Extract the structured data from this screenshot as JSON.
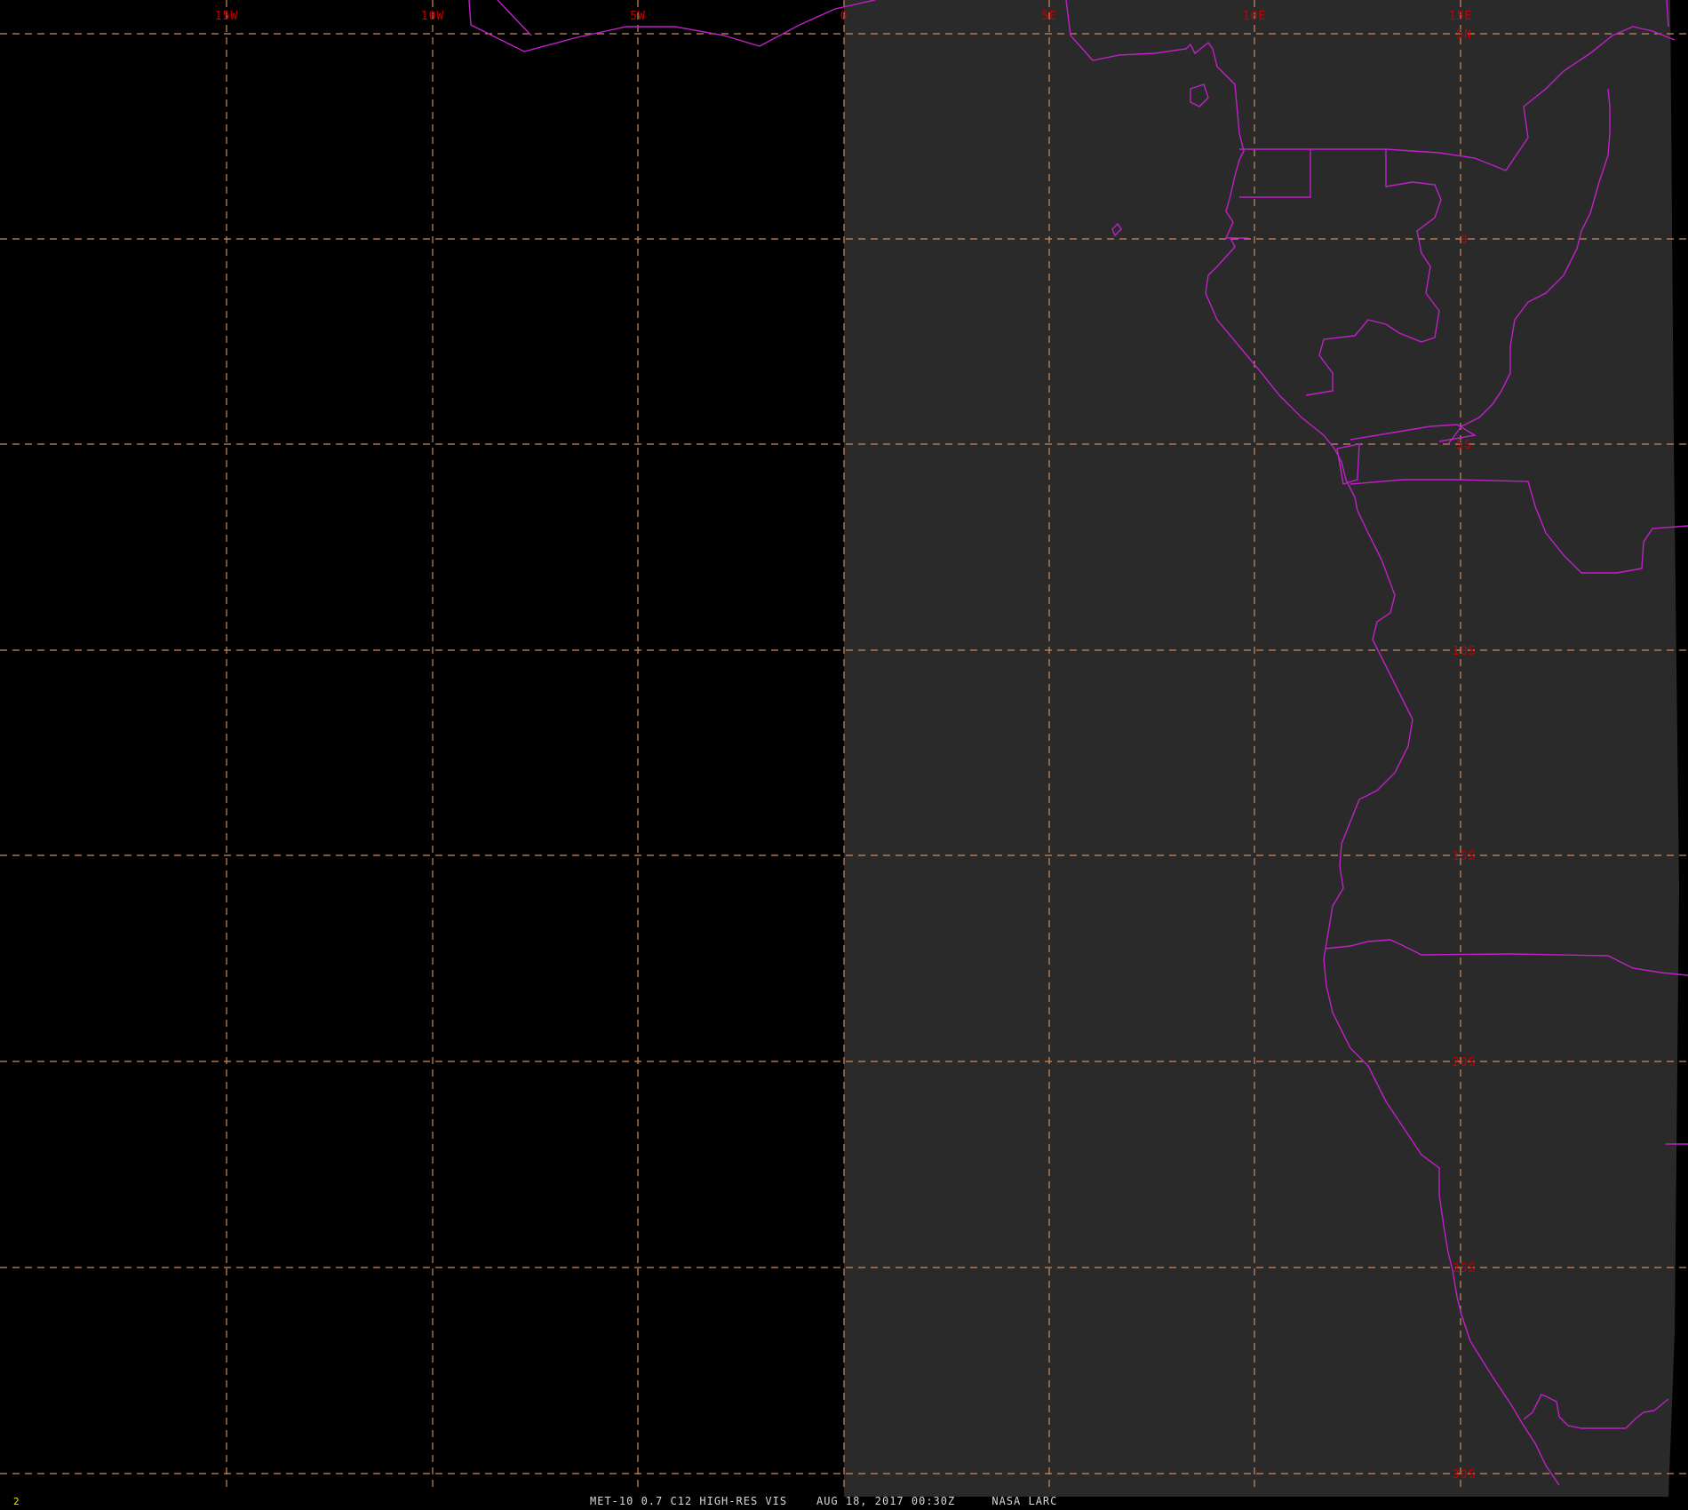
{
  "product": {
    "caption": "MET-10 0.7 C12 HIGH-RES VIS    AUG 18, 2017 00:30Z     NASA LARC",
    "frame_number": "2"
  },
  "colors": {
    "space_background": "#000000",
    "earth_disk": "#2a2a2a",
    "graticule": "#c98a5e",
    "grid_label": "#c40000",
    "coastline": "#c020c8",
    "caption_text": "#d8d8d8",
    "frame_number": "#e6e600"
  },
  "graticule": {
    "style": "dashed",
    "longitude_labels": [
      "15W",
      "10W",
      "5W",
      "0",
      "5E",
      "10E",
      "15E"
    ],
    "latitude_labels": [
      "5N",
      "0",
      "5S",
      "10S",
      "15S",
      "20S",
      "25S",
      "30S"
    ]
  },
  "overlays": [
    "country-borders",
    "coastlines",
    "lat-lon-grid"
  ]
}
